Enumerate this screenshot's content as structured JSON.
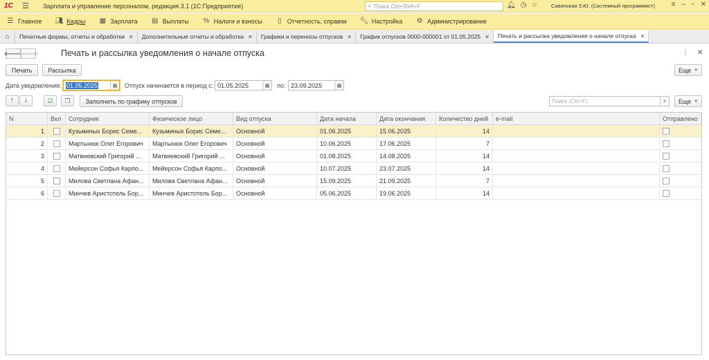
{
  "titlebar": {
    "logo": "1С",
    "app_title": "Зарплата и управление персоналом, редакция 3.1  (1С:Предприятие)",
    "search_placeholder": "Поиск Ctrl+Shift+F",
    "user": "Савинская З.Ю. (Системный программист)"
  },
  "main_menu": [
    {
      "label": "Главное",
      "icon": "menu-icon"
    },
    {
      "label": "Кадры",
      "icon": "people-icon"
    },
    {
      "label": "Зарплата",
      "icon": "salary-icon"
    },
    {
      "label": "Выплаты",
      "icon": "payments-icon"
    },
    {
      "label": "Налоги и взносы",
      "icon": "percent-icon"
    },
    {
      "label": "Отчетность, справки",
      "icon": "report-icon"
    },
    {
      "label": "Настройка",
      "icon": "wrench-icon"
    },
    {
      "label": "Администрирование",
      "icon": "gear-icon"
    }
  ],
  "tabs": [
    {
      "label": "Печатные формы, отчеты и обработки"
    },
    {
      "label": "Дополнительные отчеты и обработки"
    },
    {
      "label": "Графики и переносы отпусков"
    },
    {
      "label": "График отпусков 0000-000001 от 01.05.2025"
    },
    {
      "label": "Печать и рассылка уведомления о начале отпуска"
    }
  ],
  "form": {
    "title": "Печать и рассылка уведомления о начале отпуска",
    "print_button": "Печать",
    "mailing_button": "Рассылка",
    "more_button": "Еще",
    "notification_date_label": "Дата уведомления:",
    "notification_date": "01.05.2025",
    "period_label": "Отпуск начинается в период с:",
    "period_from": "01.05.2025",
    "period_to_label": "по:",
    "period_to": "23.09.2025",
    "fill_button": "Заполнить по графику отпусков",
    "search_placeholder": "Поиск (Ctrl+F)",
    "search_clear": "×"
  },
  "table": {
    "headers": {
      "n": "N",
      "included": "Вкл",
      "employee": "Сотрудник",
      "person": "Физическое лицо",
      "kind": "Вид отпуска",
      "start": "Дата начала",
      "end": "Дата окончания",
      "days": "Количество дней",
      "email": "e-mail",
      "sent": "Отправлено"
    },
    "rows": [
      {
        "n": "1",
        "employee": "Кузьминых Борис Семе...",
        "person": "Кузьминых Борис Семе...",
        "kind": "Основной",
        "start": "01.06.2025",
        "end": "15.06.2025",
        "days": "14",
        "email": ""
      },
      {
        "n": "2",
        "employee": "Мартынюк Олег Егорович",
        "person": "Мартынюк Олег Егорович",
        "kind": "Основной",
        "start": "10.06.2025",
        "end": "17.06.2025",
        "days": "7",
        "email": ""
      },
      {
        "n": "3",
        "employee": "Матвиевский Григорий ...",
        "person": "Матвиевский Григорий ...",
        "kind": "Основной",
        "start": "01.08.2025",
        "end": "14.08.2025",
        "days": "14",
        "email": ""
      },
      {
        "n": "4",
        "employee": "Мейерсон Софья Карпо...",
        "person": "Мейерсон Софья Карпо...",
        "kind": "Основной",
        "start": "10.07.2025",
        "end": "23.07.2025",
        "days": "14",
        "email": ""
      },
      {
        "n": "5",
        "employee": "Милова Светлана Афан...",
        "person": "Милова Светлана Афан...",
        "kind": "Основной",
        "start": "15.09.2025",
        "end": "21.09.2025",
        "days": "7",
        "email": ""
      },
      {
        "n": "6",
        "employee": "Минчев Аристотель Бор...",
        "person": "Минчев Аристотель Бор...",
        "kind": "Основной",
        "start": "05.06.2025",
        "end": "19.06.2025",
        "days": "14",
        "email": ""
      }
    ]
  },
  "colors": {
    "header_bg": "#fbed9e",
    "selected_row": "#fbf1c8",
    "active_tab_accent": "#4a8ad6"
  }
}
